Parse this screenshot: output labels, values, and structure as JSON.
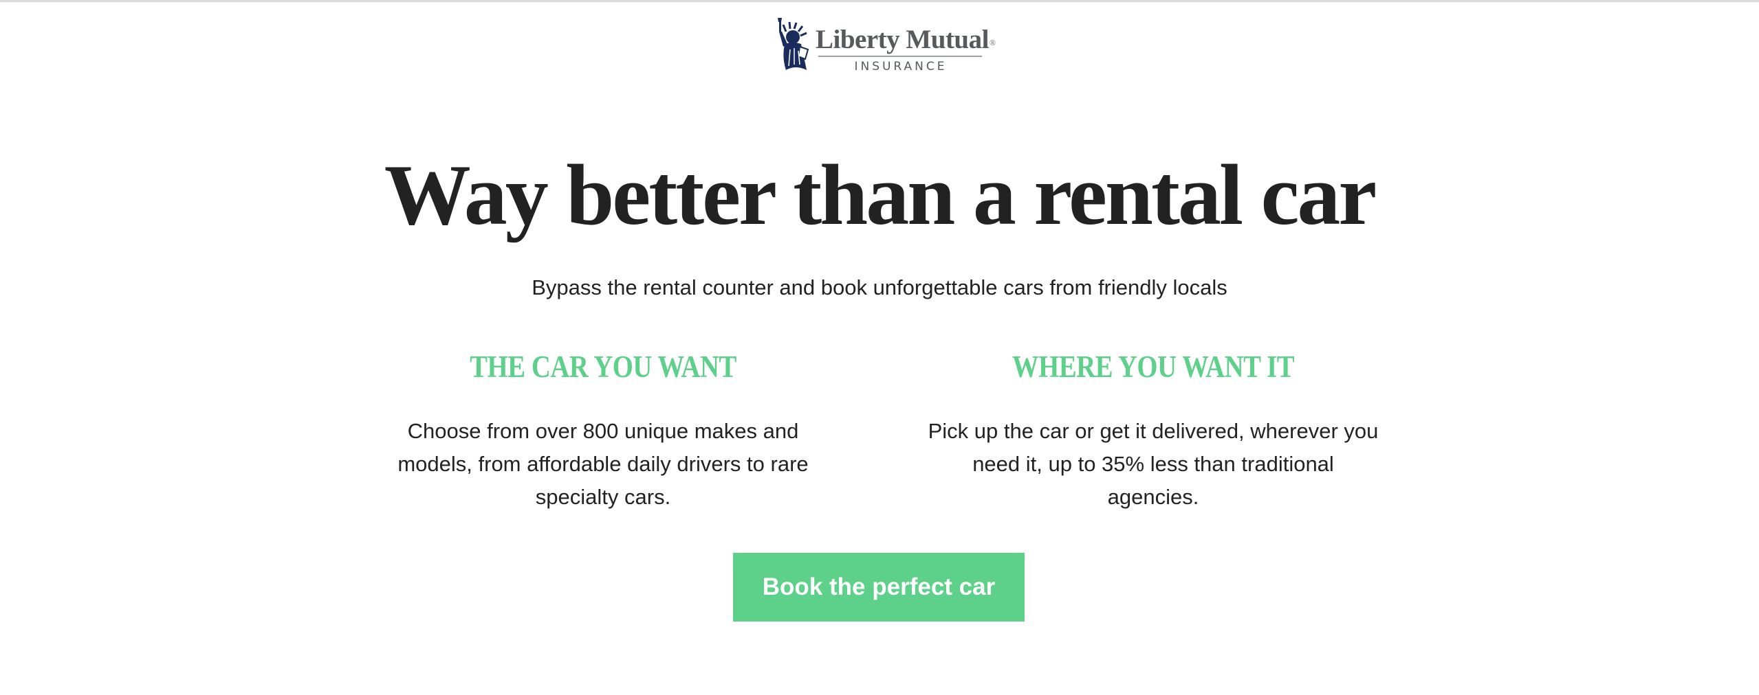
{
  "logo": {
    "brand": "Liberty Mutual",
    "registered": "®",
    "subtitle": "INSURANCE"
  },
  "hero": {
    "headline": "Way better than a rental car",
    "subheadline": "Bypass the rental counter and book unforgettable cars from friendly locals"
  },
  "features": [
    {
      "title": "THE CAR YOU WANT",
      "body": "Choose from over 800 unique makes and models, from affordable daily drivers to rare specialty cars."
    },
    {
      "title": "WHERE YOU WANT IT",
      "body": "Pick up the car or get it delivered, wherever you need it, up to 35% less than traditional agencies."
    }
  ],
  "cta": {
    "label": "Book the perfect car"
  },
  "colors": {
    "accent": "#5dd08a",
    "text": "#222222",
    "logo_navy": "#1a2c5b",
    "logo_gray": "#565a5c"
  }
}
